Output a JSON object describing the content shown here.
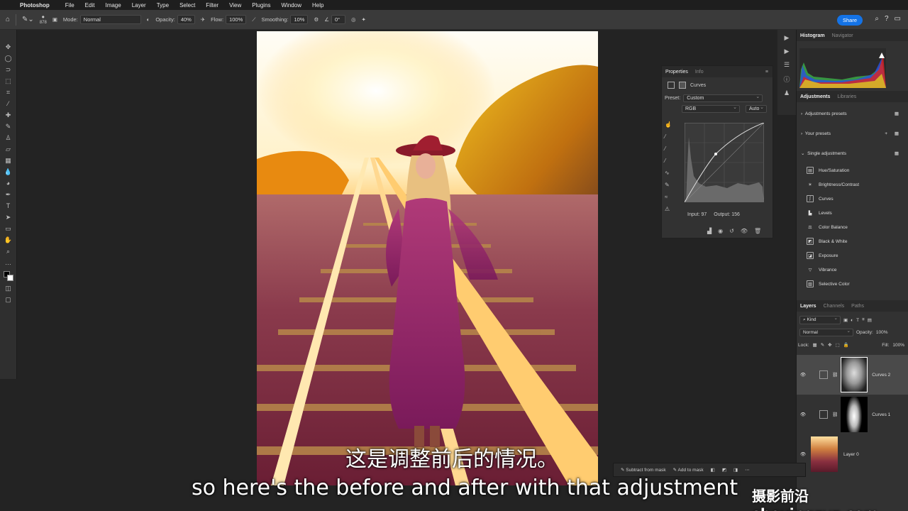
{
  "menubar": {
    "app_name": "Photoshop",
    "items": [
      "File",
      "Edit",
      "Image",
      "Layer",
      "Type",
      "Select",
      "Filter",
      "View",
      "Plugins",
      "Window",
      "Help"
    ]
  },
  "options": {
    "brush_size": "878",
    "mode_label": "Mode:",
    "mode_value": "Normal",
    "opacity_label": "Opacity:",
    "opacity_value": "40%",
    "flow_label": "Flow:",
    "flow_value": "100%",
    "smoothing_label": "Smoothing:",
    "smoothing_value": "10%",
    "angle_value": "0°",
    "share_label": "Share"
  },
  "properties": {
    "tabs": [
      "Properties",
      "Info"
    ],
    "type_label": "Curves",
    "preset_label": "Preset:",
    "preset_value": "Custom",
    "channel_value": "RGB",
    "auto_label": "Auto",
    "input_label": "Input:",
    "input_value": "97",
    "output_label": "Output:",
    "output_value": "156"
  },
  "histogram": {
    "tabs": [
      "Histogram",
      "Navigator"
    ]
  },
  "adjustments": {
    "tabs": [
      "Adjustments",
      "Libraries"
    ],
    "sections": [
      "Adjustments presets",
      "Your presets",
      "Single adjustments"
    ],
    "items": [
      "Hue/Saturation",
      "Brightness/Contrast",
      "Curves",
      "Levels",
      "Color Balance",
      "Black & White",
      "Exposure",
      "Vibrance",
      "Selective Color"
    ]
  },
  "layers": {
    "tabs": [
      "Layers",
      "Channels",
      "Paths"
    ],
    "filter_value": "Kind",
    "blend_mode": "Normal",
    "opacity_label": "Opacity:",
    "opacity_value": "100%",
    "lock_label": "Lock:",
    "fill_label": "Fill:",
    "fill_value": "100%",
    "list": [
      {
        "name": "Curves 2"
      },
      {
        "name": "Curves 1"
      },
      {
        "name": "Layer 0"
      }
    ]
  },
  "maskbar": {
    "subtract_label": "Subtract from mask",
    "add_label": "Add to mask"
  },
  "subtitles": {
    "chinese": "这是调整前后的情况。",
    "english": "so here's the before and after with that adjustment"
  },
  "watermark": "摄影前沿 sheyingzyz.com"
}
